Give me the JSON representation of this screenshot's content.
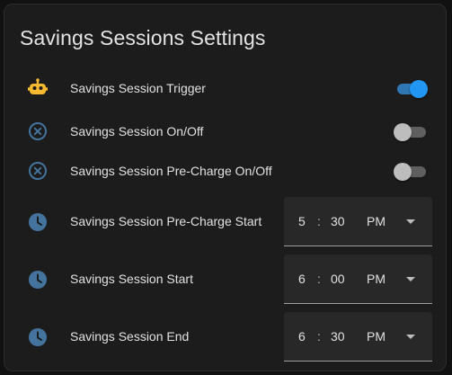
{
  "card": {
    "title": "Savings Sessions Settings"
  },
  "rows": [
    {
      "label": "Savings Session Trigger",
      "icon": "robot-icon",
      "control": "toggle",
      "on": true
    },
    {
      "label": "Savings Session On/Off",
      "icon": "close-circle-icon",
      "control": "toggle",
      "on": false
    },
    {
      "label": "Savings Session Pre-Charge On/Off",
      "icon": "close-circle-icon",
      "control": "toggle",
      "on": false
    },
    {
      "label": "Savings Session Pre-Charge Start",
      "icon": "clock-icon",
      "control": "time",
      "hour": "5",
      "sep": ":",
      "minute": "30",
      "ampm": "PM"
    },
    {
      "label": "Savings Session Start",
      "icon": "clock-icon",
      "control": "time",
      "hour": "6",
      "sep": ":",
      "minute": "00",
      "ampm": "PM"
    },
    {
      "label": "Savings Session End",
      "icon": "clock-icon",
      "control": "time",
      "hour": "6",
      "sep": ":",
      "minute": "30",
      "ampm": "PM"
    }
  ],
  "colors": {
    "robot_icon": "#f6b92f",
    "state_icon": "#44739e",
    "toggle_on": "#2196f3",
    "card_background": "#1c1c1c"
  }
}
